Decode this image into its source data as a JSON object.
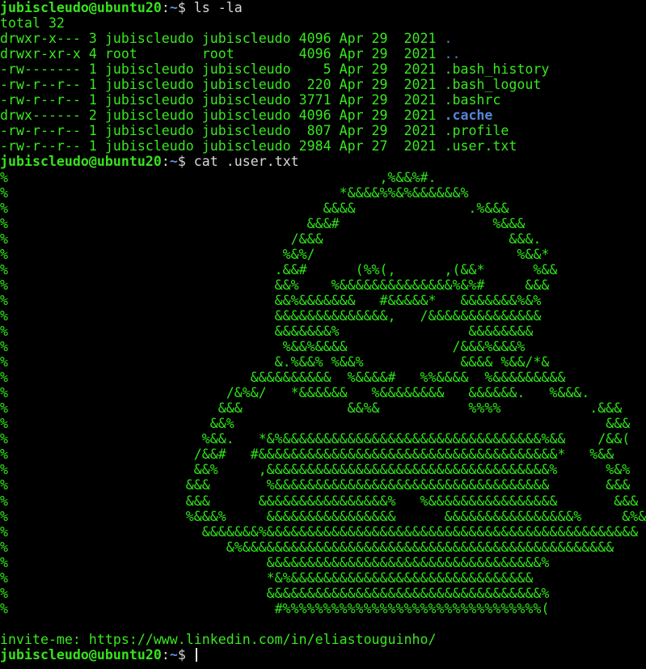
{
  "prompt": {
    "user_host": "jubiscleudo@ubuntu20",
    "colon": ":",
    "path": "~",
    "dollar": "$ "
  },
  "commands": {
    "ls": "ls -la",
    "cat": "cat .user.txt"
  },
  "ls_output": {
    "total": "total 32",
    "rows": [
      {
        "meta": "drwxr-x--- 3 jubiscleudo jubiscleudo 4096 Apr 29  2021 ",
        "name": "."
      },
      {
        "meta": "drwxr-xr-x 4 root        root        4096 Apr 29  2021 ",
        "name": ".."
      },
      {
        "meta": "-rw------- 1 jubiscleudo jubiscleudo    5 Apr 29  2021 ",
        "name": ".bash_history"
      },
      {
        "meta": "-rw-r--r-- 1 jubiscleudo jubiscleudo  220 Apr 29  2021 ",
        "name": ".bash_logout"
      },
      {
        "meta": "-rw-r--r-- 1 jubiscleudo jubiscleudo 3771 Apr 29  2021 ",
        "name": ".bashrc"
      },
      {
        "meta": "drwx------ 2 jubiscleudo jubiscleudo 4096 Apr 29  2021 ",
        "name": ".cache"
      },
      {
        "meta": "-rw-r--r-- 1 jubiscleudo jubiscleudo  807 Apr 29  2021 ",
        "name": ".profile"
      },
      {
        "meta": "-rw-r--r-- 1 jubiscleudo jubiscleudo 2984 Apr 27  2021 ",
        "name": ".user.txt"
      }
    ]
  },
  "ascii_art": [
    "%                                              ,%&&%#.",
    "%                                         *&&&&%%&%&&&&&&%",
    "%                                       &&&&              .%&&&",
    "%                                     &&&#                   %&&&",
    "%                                   /&&&                       &&&.",
    "%                                  %&%/                         %&&*",
    "%                                 .&&#      (%%(,      ,(&&*      %&&",
    "%                                 &&%    %&&&&&&&&&&&&&&%&%#     &&&",
    "%                                 &&%&&&&&&&   #&&&&&*   &&&&&&&%&%",
    "%                                 &&&&&&&&&&&&&&,   /&&&&&&&&&&&&&&",
    "%                                 &&&&&&&%                &&&&&&&&",
    "%                                  %&&%&&&&             /&&&%&&&%",
    "%                                 &.%&&% %&&%            &&&& %&&/*&",
    "%                              &&&&&&&&&&  %&&&&#   %%&&&&  %&&&&&&&&&",
    "%                           /&%&/   *&&&&&&   %&&&&&&&&   &&&&&&.   %&&&.",
    "%                          &&&             &&%&           %%%%           .&&&",
    "%                         &&%                                              &&&",
    "%                        %&&.   *&%&&&&&&&&&&&&&&&&&&&&&&&&&&&&&&&&%&&    /&&(",
    "%                       /&&#   #&&&&&&&&&&&&&&&&&&&&&&&&&&&&&&&&&&&&&*   %&&",
    "%                       &&%     ,&&&&&&&&&&&&&&&&&&&&&&&&&&&&&&&&&&&%      %&%",
    "%                      &&&       %&&&&&&&&&&&&&&&&&&&&&&&&&&&&&&&&&&       &&&",
    "%                      &&&      &&&&&&&&&&&&&&&&%   %&&&&&&&&&&&&&&&&       &&&",
    "%                      %&&&%     &&&&&&&&&&&&&&&&      &&&&&&&&&&&&&&&&%     &%&&#",
    "%                        &&&&&&&%&&&&&&&&&&&&&&&&&&&&&&&&&&&&&&&&&&&&&&&&&&&&&&",
    "%                           &%&&&&&&&&&&&&&&&&&&&&&&&&&&&&&&&&&&&&&&&&&&&&&&",
    "%                                &&&&&&&&&&&&&&&&&&&&&&&&&&&&&&&&&&%",
    "%                                *&%&&&&&&&&&&&&&&&&&&&&&&&&&&&&&&",
    "%                                &&&&&&&&&&&&&&&&&&&&&&&&&&&&&&&&&&%",
    "%                                 #%%%%%%%%%%%%%%%%%%%%%%%%%%%%%%%%("
  ],
  "invite": "invite-me: https://www.linkedin.com/in/eliastouguinho/"
}
